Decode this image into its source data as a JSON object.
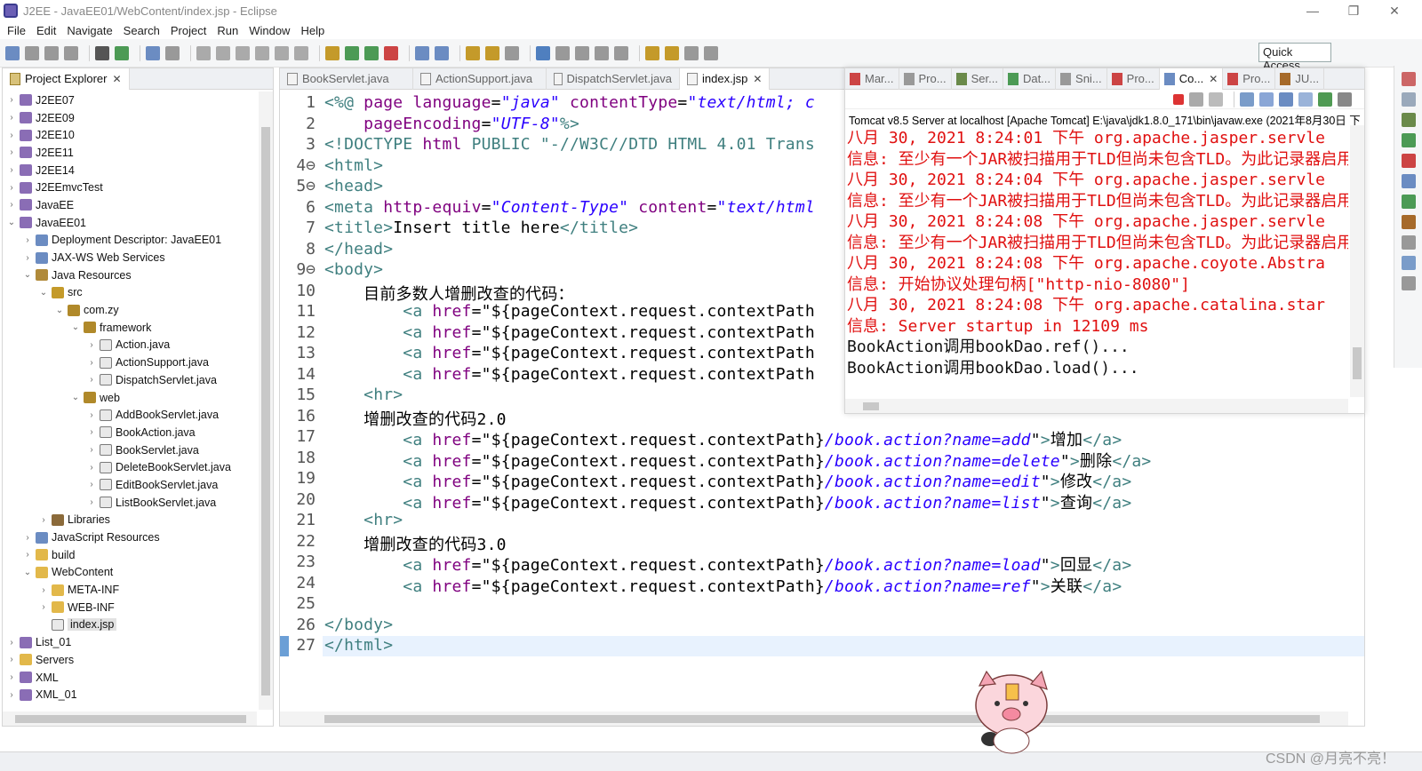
{
  "window": {
    "title": "J2EE - JavaEE01/WebContent/index.jsp - Eclipse",
    "min": "—",
    "max": "❐",
    "close": "✕"
  },
  "menu": [
    "File",
    "Edit",
    "Navigate",
    "Search",
    "Project",
    "Run",
    "Window",
    "Help"
  ],
  "toolbar": {
    "quick_access": "Quick Access"
  },
  "project_explorer": {
    "tab_label": "Project Explorer",
    "close": "✕",
    "rows": [
      {
        "label": "J2EE07",
        "arrow": "›",
        "depth": 0,
        "icon": "project-icon"
      },
      {
        "label": "J2EE09",
        "arrow": "›",
        "depth": 0,
        "icon": "project-icon"
      },
      {
        "label": "J2EE10",
        "arrow": "›",
        "depth": 0,
        "icon": "project-icon"
      },
      {
        "label": "J2EE11",
        "arrow": "›",
        "depth": 0,
        "icon": "project-icon"
      },
      {
        "label": "J2EE14",
        "arrow": "›",
        "depth": 0,
        "icon": "project-icon"
      },
      {
        "label": "J2EEmvcTest",
        "arrow": "›",
        "depth": 0,
        "icon": "project-icon"
      },
      {
        "label": "JavaEE",
        "arrow": "›",
        "depth": 0,
        "icon": "project-icon"
      },
      {
        "label": "JavaEE01",
        "arrow": "⌄",
        "depth": 0,
        "icon": "project-icon"
      },
      {
        "label": "Deployment Descriptor: JavaEE01",
        "arrow": "›",
        "depth": 1,
        "icon": "descriptor-icon"
      },
      {
        "label": "JAX-WS Web Services",
        "arrow": "›",
        "depth": 1,
        "icon": "webservice-icon"
      },
      {
        "label": "Java Resources",
        "arrow": "⌄",
        "depth": 1,
        "icon": "java-resources-icon"
      },
      {
        "label": "src",
        "arrow": "⌄",
        "depth": 2,
        "icon": "source-folder-icon"
      },
      {
        "label": "com.zy",
        "arrow": "⌄",
        "depth": 3,
        "icon": "package-icon"
      },
      {
        "label": "framework",
        "arrow": "⌄",
        "depth": 4,
        "icon": "package-icon"
      },
      {
        "label": "Action.java",
        "arrow": "›",
        "depth": 5,
        "icon": "java-file-icon"
      },
      {
        "label": "ActionSupport.java",
        "arrow": "›",
        "depth": 5,
        "icon": "java-file-icon"
      },
      {
        "label": "DispatchServlet.java",
        "arrow": "›",
        "depth": 5,
        "icon": "java-file-icon"
      },
      {
        "label": "web",
        "arrow": "⌄",
        "depth": 4,
        "icon": "package-icon"
      },
      {
        "label": "AddBookServlet.java",
        "arrow": "›",
        "depth": 5,
        "icon": "java-file-icon"
      },
      {
        "label": "BookAction.java",
        "arrow": "›",
        "depth": 5,
        "icon": "java-file-icon"
      },
      {
        "label": "BookServlet.java",
        "arrow": "›",
        "depth": 5,
        "icon": "java-file-icon"
      },
      {
        "label": "DeleteBookServlet.java",
        "arrow": "›",
        "depth": 5,
        "icon": "java-file-icon"
      },
      {
        "label": "EditBookServlet.java",
        "arrow": "›",
        "depth": 5,
        "icon": "java-file-icon"
      },
      {
        "label": "ListBookServlet.java",
        "arrow": "›",
        "depth": 5,
        "icon": "java-file-icon"
      },
      {
        "label": "Libraries",
        "arrow": "›",
        "depth": 2,
        "icon": "library-icon"
      },
      {
        "label": "JavaScript Resources",
        "arrow": "›",
        "depth": 1,
        "icon": "js-resources-icon"
      },
      {
        "label": "build",
        "arrow": "›",
        "depth": 1,
        "icon": "folder-icon"
      },
      {
        "label": "WebContent",
        "arrow": "⌄",
        "depth": 1,
        "icon": "folder-icon"
      },
      {
        "label": "META-INF",
        "arrow": "›",
        "depth": 2,
        "icon": "folder-icon"
      },
      {
        "label": "WEB-INF",
        "arrow": "›",
        "depth": 2,
        "icon": "folder-icon"
      },
      {
        "label": "index.jsp",
        "arrow": "",
        "depth": 2,
        "icon": "jsp-file-icon",
        "selected": true
      },
      {
        "label": "List_01",
        "arrow": "›",
        "depth": 0,
        "icon": "project-icon"
      },
      {
        "label": "Servers",
        "arrow": "›",
        "depth": 0,
        "icon": "folder-icon"
      },
      {
        "label": "XML",
        "arrow": "›",
        "depth": 0,
        "icon": "project-icon"
      },
      {
        "label": "XML_01",
        "arrow": "›",
        "depth": 0,
        "icon": "project-icon"
      }
    ]
  },
  "editor": {
    "tabs": [
      {
        "label": "BookServlet.java",
        "active": false
      },
      {
        "label": "ActionSupport.java",
        "active": false
      },
      {
        "label": "DispatchServlet.java",
        "active": false
      },
      {
        "label": "index.jsp",
        "active": true
      }
    ],
    "lines": [
      {
        "n": "1",
        "html": "<span class=\"tag\">&lt;%@</span> <span class=\"attr\">page</span> <span class=\"attr\">language</span>=<span class=\"str\">\"java\"</span> <span class=\"attr\">contentType</span>=<span class=\"str\">\"text/html; c</span>"
      },
      {
        "n": "2",
        "html": "    <span class=\"attr\">pageEncoding</span>=<span class=\"str\">\"UTF-8\"</span><span class=\"tag\">%&gt;</span>"
      },
      {
        "n": "3",
        "html": "<span class=\"el\">&lt;!DOCTYPE</span> <span class=\"attr\">html</span> <span class=\"el\">PUBLIC</span> <span class=\"el\">\"-//W3C//DTD HTML 4.01 Trans</span>"
      },
      {
        "n": "4⊖",
        "html": "<span class=\"tag\">&lt;html&gt;</span>"
      },
      {
        "n": "5⊖",
        "html": "<span class=\"tag\">&lt;head&gt;</span>"
      },
      {
        "n": "6",
        "html": "<span class=\"tag\">&lt;meta</span> <span class=\"attr\">http-equiv</span>=<span class=\"str\">\"Content-Type\"</span> <span class=\"attr\">content</span>=<span class=\"str\">\"text/html</span>"
      },
      {
        "n": "7",
        "html": "<span class=\"tag\">&lt;title&gt;</span>Insert title here<span class=\"tag\">&lt;/title&gt;</span>"
      },
      {
        "n": "8",
        "html": "<span class=\"tag\">&lt;/head&gt;</span>"
      },
      {
        "n": "9⊖",
        "html": "<span class=\"tag\">&lt;body&gt;</span>"
      },
      {
        "n": "10",
        "html": "    目前多数人增删改查的代码："
      },
      {
        "n": "11",
        "html": "        <span class=\"tag\">&lt;a</span> <span class=\"attr\">href</span>=\"${pageContext.request.contextPath"
      },
      {
        "n": "12",
        "html": "        <span class=\"tag\">&lt;a</span> <span class=\"attr\">href</span>=\"${pageContext.request.contextPath"
      },
      {
        "n": "13",
        "html": "        <span class=\"tag\">&lt;a</span> <span class=\"attr\">href</span>=\"${pageContext.request.contextPath"
      },
      {
        "n": "14",
        "html": "        <span class=\"tag\">&lt;a</span> <span class=\"attr\">href</span>=\"${pageContext.request.contextPath"
      },
      {
        "n": "15",
        "html": "    <span class=\"tag\">&lt;hr&gt;</span>"
      },
      {
        "n": "16",
        "html": "    增删改查的代码2.0"
      },
      {
        "n": "17",
        "html": "        <span class=\"tag\">&lt;a</span> <span class=\"attr\">href</span>=\"${pageContext.request.contextPath}<span class=\"str\">/book.action?name=add</span>\"<span class=\"tag\">&gt;</span>增加<span class=\"tag\">&lt;/a&gt;</span>"
      },
      {
        "n": "18",
        "html": "        <span class=\"tag\">&lt;a</span> <span class=\"attr\">href</span>=\"${pageContext.request.contextPath}<span class=\"str\">/book.action?name=delete</span>\"<span class=\"tag\">&gt;</span>删除<span class=\"tag\">&lt;/a&gt;</span>"
      },
      {
        "n": "19",
        "html": "        <span class=\"tag\">&lt;a</span> <span class=\"attr\">href</span>=\"${pageContext.request.contextPath}<span class=\"str\">/book.action?name=edit</span>\"<span class=\"tag\">&gt;</span>修改<span class=\"tag\">&lt;/a&gt;</span>"
      },
      {
        "n": "20",
        "html": "        <span class=\"tag\">&lt;a</span> <span class=\"attr\">href</span>=\"${pageContext.request.contextPath}<span class=\"str\">/book.action?name=list</span>\"<span class=\"tag\">&gt;</span>查询<span class=\"tag\">&lt;/a&gt;</span>"
      },
      {
        "n": "21",
        "html": "    <span class=\"tag\">&lt;hr&gt;</span>"
      },
      {
        "n": "22",
        "html": "    增删改查的代码3.0"
      },
      {
        "n": "23",
        "html": "        <span class=\"tag\">&lt;a</span> <span class=\"attr\">href</span>=\"${pageContext.request.contextPath}<span class=\"str\">/book.action?name=load</span>\"<span class=\"tag\">&gt;</span>回显<span class=\"tag\">&lt;/a&gt;</span>"
      },
      {
        "n": "24",
        "html": "        <span class=\"tag\">&lt;a</span> <span class=\"attr\">href</span>=\"${pageContext.request.contextPath}<span class=\"str\">/book.action?name=ref</span>\"<span class=\"tag\">&gt;</span>关联<span class=\"tag\">&lt;/a&gt;</span>"
      },
      {
        "n": "25",
        "html": ""
      },
      {
        "n": "26",
        "html": "<span class=\"tag\">&lt;/body&gt;</span>"
      },
      {
        "n": "27",
        "html": "<span class=\"tag\">&lt;/html&gt;</span>"
      }
    ]
  },
  "console": {
    "tabs": [
      "Mar...",
      "Pro...",
      "Ser...",
      "Dat...",
      "Sni...",
      "Pro...",
      "Co...",
      "Pro...",
      "JU..."
    ],
    "active_tab": "Co...",
    "header": "Tomcat v8.5 Server at localhost [Apache Tomcat] E:\\java\\jdk1.8.0_171\\bin\\javaw.exe (2021年8月30日 下",
    "lines": [
      {
        "text": "八月 30, 2021 8:24:01 下午 org.apache.jasper.servle",
        "color": "red"
      },
      {
        "text": "信息: 至少有一个JAR被扫描用于TLD但尚未包含TLD。为此记录器启用调",
        "color": "red"
      },
      {
        "text": "八月 30, 2021 8:24:04 下午 org.apache.jasper.servle",
        "color": "red"
      },
      {
        "text": "信息: 至少有一个JAR被扫描用于TLD但尚未包含TLD。为此记录器启用调",
        "color": "red"
      },
      {
        "text": "八月 30, 2021 8:24:08 下午 org.apache.jasper.servle",
        "color": "red"
      },
      {
        "text": "信息: 至少有一个JAR被扫描用于TLD但尚未包含TLD。为此记录器启用调",
        "color": "red"
      },
      {
        "text": "八月 30, 2021 8:24:08 下午 org.apache.coyote.Abstra",
        "color": "red"
      },
      {
        "text": "信息: 开始协议处理句柄[\"http-nio-8080\"]",
        "color": "red"
      },
      {
        "text": "八月 30, 2021 8:24:08 下午 org.apache.catalina.star",
        "color": "red"
      },
      {
        "text": "信息: Server startup in 12109 ms",
        "color": "red"
      },
      {
        "text": "BookAction调用bookDao.ref()...",
        "color": "black"
      },
      {
        "text": "BookAction调用bookDao.load()...",
        "color": "black"
      }
    ]
  },
  "watermark": "CSDN @月亮不亮！",
  "colors": {
    "error_text": "#e01010",
    "accent": "#2a00ff"
  }
}
